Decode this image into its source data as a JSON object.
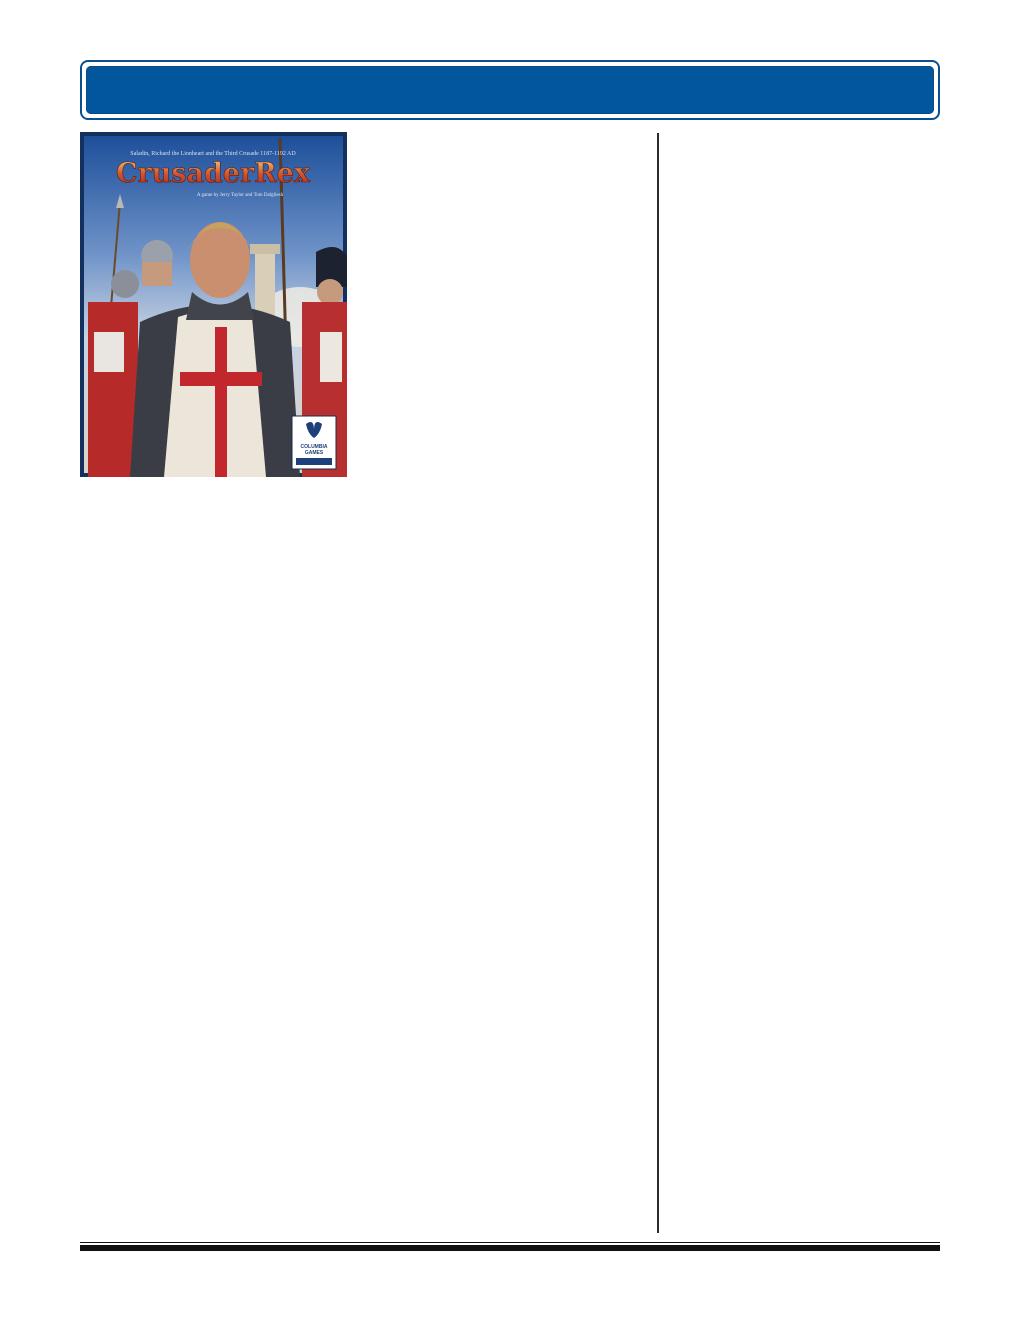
{
  "header": {
    "title": ""
  },
  "cover": {
    "subtitle": "Saladin, Richard the Lionheart and the Third Crusade 1187-1192 AD",
    "title": "CrusaderRex",
    "credits": "A game by Jerry Taylor and Tom Dalgliesh",
    "publisher_line1": "COLUMBIA",
    "publisher_line2": "GAMES"
  }
}
